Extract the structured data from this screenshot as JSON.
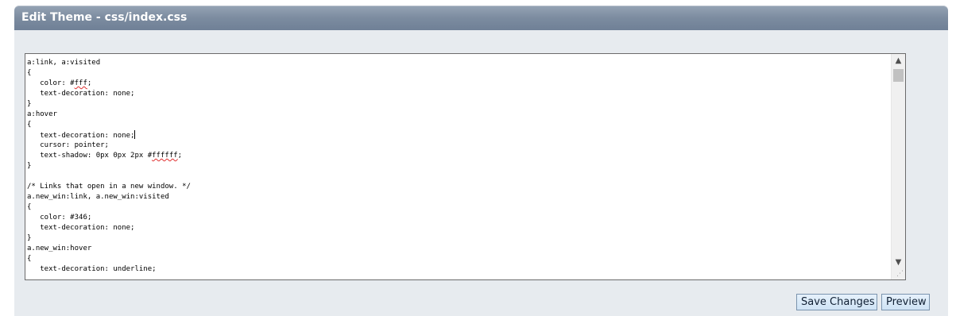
{
  "window": {
    "title": "Edit Theme - css/index.css"
  },
  "editor": {
    "lines": [
      "a:link, a:visited",
      "{",
      "   color: #fff;",
      "   text-decoration: none;",
      "}",
      "a:hover",
      "{",
      "   text-decoration: none;",
      "   cursor: pointer;",
      "   text-shadow: 0px 0px 2px #ffffff;",
      "}",
      "",
      "/* Links that open in a new window. */",
      "a.new_win:link, a.new_win:visited",
      "{",
      "   color: #346;",
      "   text-decoration: none;",
      "}",
      "a.new_win:hover",
      "{",
      "   text-decoration: underline;"
    ],
    "caret_line": 7,
    "spellcheck": [
      {
        "line": 2,
        "word": "fff"
      },
      {
        "line": 9,
        "word": "ffffff"
      }
    ],
    "scrollbar": {
      "up_icon": "▲",
      "down_icon": "▼",
      "grip_icon": "⋰"
    }
  },
  "actions": {
    "save_label": "Save Changes",
    "preview_label": "Preview"
  }
}
